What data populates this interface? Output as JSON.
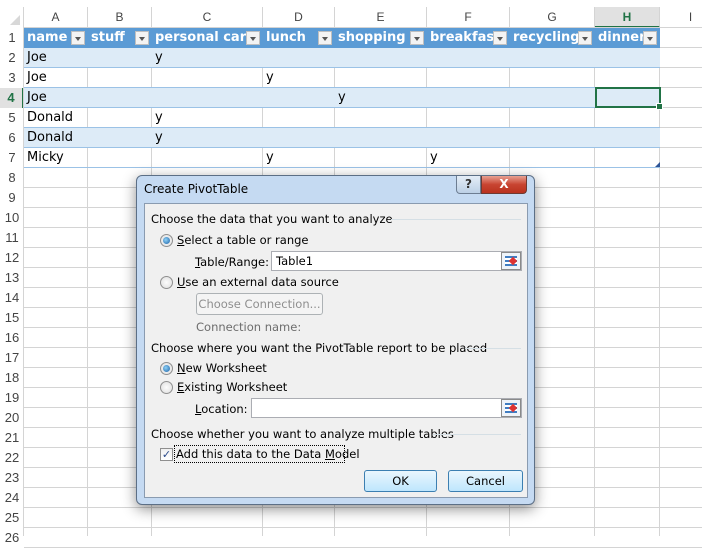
{
  "spreadsheet": {
    "columns": [
      "A",
      "B",
      "C",
      "D",
      "E",
      "F",
      "G",
      "H",
      "I"
    ],
    "selected_column": "H",
    "rows": [
      "1",
      "2",
      "3",
      "4",
      "5",
      "6",
      "7",
      "8",
      "9",
      "10",
      "11",
      "12",
      "13",
      "14",
      "15",
      "16",
      "17",
      "18",
      "19",
      "20",
      "21",
      "22",
      "23",
      "24",
      "25",
      "26"
    ],
    "selected_row": "4",
    "selected_cell": "H4",
    "table_headers": [
      "name",
      "stuff",
      "personal care",
      "lunch",
      "shopping",
      "breakfast",
      "recycling",
      "dinner"
    ],
    "table_rows": [
      [
        "Joe",
        "",
        "y",
        "",
        "",
        "",
        "",
        ""
      ],
      [
        "Joe",
        "",
        "",
        "y",
        "",
        "",
        "",
        ""
      ],
      [
        "Joe",
        "",
        "",
        "",
        "y",
        "",
        "",
        ""
      ],
      [
        "Donald",
        "",
        "y",
        "",
        "",
        "",
        "",
        ""
      ],
      [
        "Donald",
        "",
        "y",
        "",
        "",
        "",
        "",
        ""
      ],
      [
        "Micky",
        "",
        "",
        "y",
        "",
        "y",
        "",
        ""
      ]
    ],
    "colors": {
      "header_fill": "#5b9bd5",
      "band_fill": "#ddebf7",
      "accent": "#217346"
    }
  },
  "dialog": {
    "title": "Create PivotTable",
    "help_label": "?",
    "close_label": "X",
    "section1": "Choose the data that you want to analyze",
    "radio_select_table": "Select a table or range",
    "table_range_label": "Table/Range:",
    "table_range_value": "Table1",
    "radio_external": "Use an external data source",
    "choose_connection_label": "Choose Connection...",
    "connection_name_label": "Connection name:",
    "section2": "Choose where you want the PivotTable report to be placed",
    "radio_new_worksheet": "New Worksheet",
    "radio_existing_worksheet": "Existing Worksheet",
    "location_label": "Location:",
    "location_value": "",
    "section3": "Choose whether you want to analyze multiple tables",
    "checkbox_data_model": "Add this data to the Data Model",
    "checkbox_data_model_checked": true,
    "ok_label": "OK",
    "cancel_label": "Cancel",
    "selected_source": "Select a table or range",
    "selected_destination": "New Worksheet"
  }
}
